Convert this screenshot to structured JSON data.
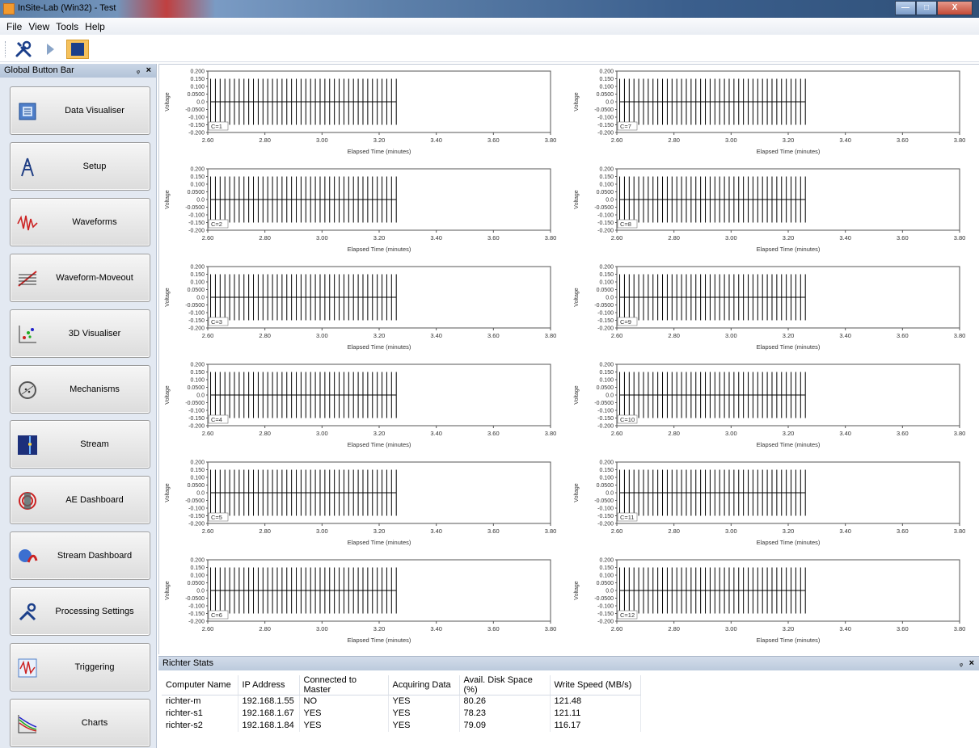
{
  "window": {
    "title": "InSite-Lab (Win32) - Test",
    "min_label": "—",
    "max_label": "□",
    "close_label": "X"
  },
  "menu": [
    "File",
    "View",
    "Tools",
    "Help"
  ],
  "toolbar": {
    "tools_icon": "wrench-screwdriver-icon",
    "play_icon": "play-icon",
    "stop_icon": "stop-icon"
  },
  "left_panel": {
    "title": "Global Button Bar",
    "pin": "ᵩ",
    "close": "×",
    "buttons": [
      {
        "label": "Data Visualiser",
        "icon": "data-visualiser-icon"
      },
      {
        "label": "Setup",
        "icon": "setup-tower-icon"
      },
      {
        "label": "Waveforms",
        "icon": "waveforms-icon"
      },
      {
        "label": "Waveform-Moveout",
        "icon": "waveform-moveout-icon"
      },
      {
        "label": "3D Visualiser",
        "icon": "3d-visualiser-icon"
      },
      {
        "label": "Mechanisms",
        "icon": "mechanisms-icon"
      },
      {
        "label": "Stream",
        "icon": "stream-icon"
      },
      {
        "label": "AE Dashboard",
        "icon": "ae-dashboard-icon"
      },
      {
        "label": "Stream Dashboard",
        "icon": "stream-dashboard-icon"
      },
      {
        "label": "Processing Settings",
        "icon": "processing-settings-icon"
      },
      {
        "label": "Triggering",
        "icon": "triggering-icon"
      },
      {
        "label": "Charts",
        "icon": "charts-icon"
      }
    ]
  },
  "charts": {
    "ylabel": "Voltage",
    "xlabel": "Elapsed Time (minutes)",
    "ytick_labels": [
      "0.200",
      "0.150",
      "0.100",
      "0.0500",
      "0.0",
      "-0.0500",
      "-0.100",
      "-0.150",
      "-0.200"
    ],
    "xtick_labels": [
      "2.60",
      "2.80",
      "3.00",
      "3.20",
      "3.40",
      "3.60",
      "3.80"
    ],
    "channels": [
      "C=1",
      "C=2",
      "C=3",
      "C=4",
      "C=5",
      "C=6",
      "C=7",
      "C=8",
      "C=9",
      "C=10",
      "C=11",
      "C=12"
    ]
  },
  "chart_data": {
    "type": "line",
    "title": "",
    "xlabel": "Elapsed Time (minutes)",
    "ylabel": "Voltage",
    "xlim": [
      2.6,
      3.8
    ],
    "ylim": [
      -0.2,
      0.2
    ],
    "panels": 12,
    "series": [
      {
        "name": "C=1",
        "spikes_x_range": [
          2.61,
          3.26
        ],
        "spike_amplitude": [
          -0.15,
          0.15
        ],
        "baseline": 0.0
      },
      {
        "name": "C=2",
        "spikes_x_range": [
          2.61,
          3.26
        ],
        "spike_amplitude": [
          -0.15,
          0.15
        ],
        "baseline": 0.0
      },
      {
        "name": "C=3",
        "spikes_x_range": [
          2.61,
          3.26
        ],
        "spike_amplitude": [
          -0.15,
          0.15
        ],
        "baseline": 0.0
      },
      {
        "name": "C=4",
        "spikes_x_range": [
          2.61,
          3.26
        ],
        "spike_amplitude": [
          -0.15,
          0.15
        ],
        "baseline": 0.0
      },
      {
        "name": "C=5",
        "spikes_x_range": [
          2.61,
          3.26
        ],
        "spike_amplitude": [
          -0.15,
          0.15
        ],
        "baseline": 0.0
      },
      {
        "name": "C=6",
        "spikes_x_range": [
          2.61,
          3.26
        ],
        "spike_amplitude": [
          -0.15,
          0.15
        ],
        "baseline": 0.0
      },
      {
        "name": "C=7",
        "spikes_x_range": [
          2.61,
          3.26
        ],
        "spike_amplitude": [
          -0.15,
          0.15
        ],
        "baseline": 0.0
      },
      {
        "name": "C=8",
        "spikes_x_range": [
          2.61,
          3.26
        ],
        "spike_amplitude": [
          -0.15,
          0.15
        ],
        "baseline": 0.0
      },
      {
        "name": "C=9",
        "spikes_x_range": [
          2.61,
          3.26
        ],
        "spike_amplitude": [
          -0.15,
          0.15
        ],
        "baseline": 0.0
      },
      {
        "name": "C=10",
        "spikes_x_range": [
          2.61,
          3.26
        ],
        "spike_amplitude": [
          -0.15,
          0.15
        ],
        "baseline": 0.0
      },
      {
        "name": "C=11",
        "spikes_x_range": [
          2.61,
          3.26
        ],
        "spike_amplitude": [
          -0.15,
          0.15
        ],
        "baseline": 0.0
      },
      {
        "name": "C=12",
        "spikes_x_range": [
          2.61,
          3.26
        ],
        "spike_amplitude": [
          -0.15,
          0.15
        ],
        "baseline": 0.0
      }
    ],
    "grid": false
  },
  "stats": {
    "title": "Richter Stats",
    "pin": "ᵩ",
    "close": "×",
    "columns": [
      "Computer Name",
      "IP Address",
      "Connected to Master",
      "Acquiring Data",
      "Avail. Disk Space (%)",
      "Write Speed (MB/s)"
    ],
    "rows": [
      [
        "richter-m",
        "192.168.1.55",
        "NO",
        "YES",
        "80.26",
        "121.48"
      ],
      [
        "richter-s1",
        "192.168.1.67",
        "YES",
        "YES",
        "78.23",
        "121.11"
      ],
      [
        "richter-s2",
        "192.168.1.84",
        "YES",
        "YES",
        "79.09",
        "116.17"
      ]
    ]
  }
}
